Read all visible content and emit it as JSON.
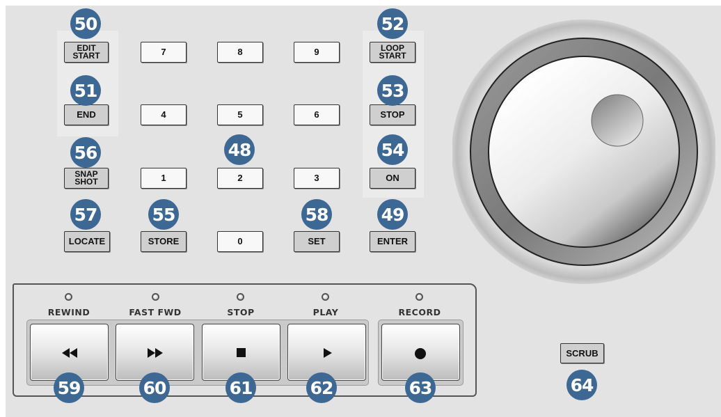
{
  "keypad": {
    "edit_start": "EDIT\nSTART",
    "end": "END",
    "snapshot": "SNAP\nSHOT",
    "locate": "LOCATE",
    "store": "STORE",
    "set": "SET",
    "enter": "ENTER",
    "loop_start": "LOOP\nSTART",
    "stop": "STOP",
    "on": "ON",
    "digits": {
      "d7": "7",
      "d8": "8",
      "d9": "9",
      "d4": "4",
      "d5": "5",
      "d6": "6",
      "d1": "1",
      "d2": "2",
      "d3": "3",
      "d0": "0"
    }
  },
  "transport": {
    "rewind": "REWIND",
    "fast_fwd": "FAST FWD",
    "stop": "STOP",
    "play": "PLAY",
    "record": "RECORD"
  },
  "scrub": "SCRUB",
  "callouts": {
    "c48": "48",
    "c49": "49",
    "c50": "50",
    "c51": "51",
    "c52": "52",
    "c53": "53",
    "c54": "54",
    "c55": "55",
    "c56": "56",
    "c57": "57",
    "c58": "58",
    "c59": "59",
    "c60": "60",
    "c61": "61",
    "c62": "62",
    "c63": "63",
    "c64": "64"
  },
  "colors": {
    "callout": "#3d6894",
    "panel": "#e3e3e3"
  },
  "icons": [
    "rewind-icon",
    "fast-forward-icon",
    "stop-icon",
    "play-icon",
    "record-icon",
    "jog-wheel"
  ]
}
